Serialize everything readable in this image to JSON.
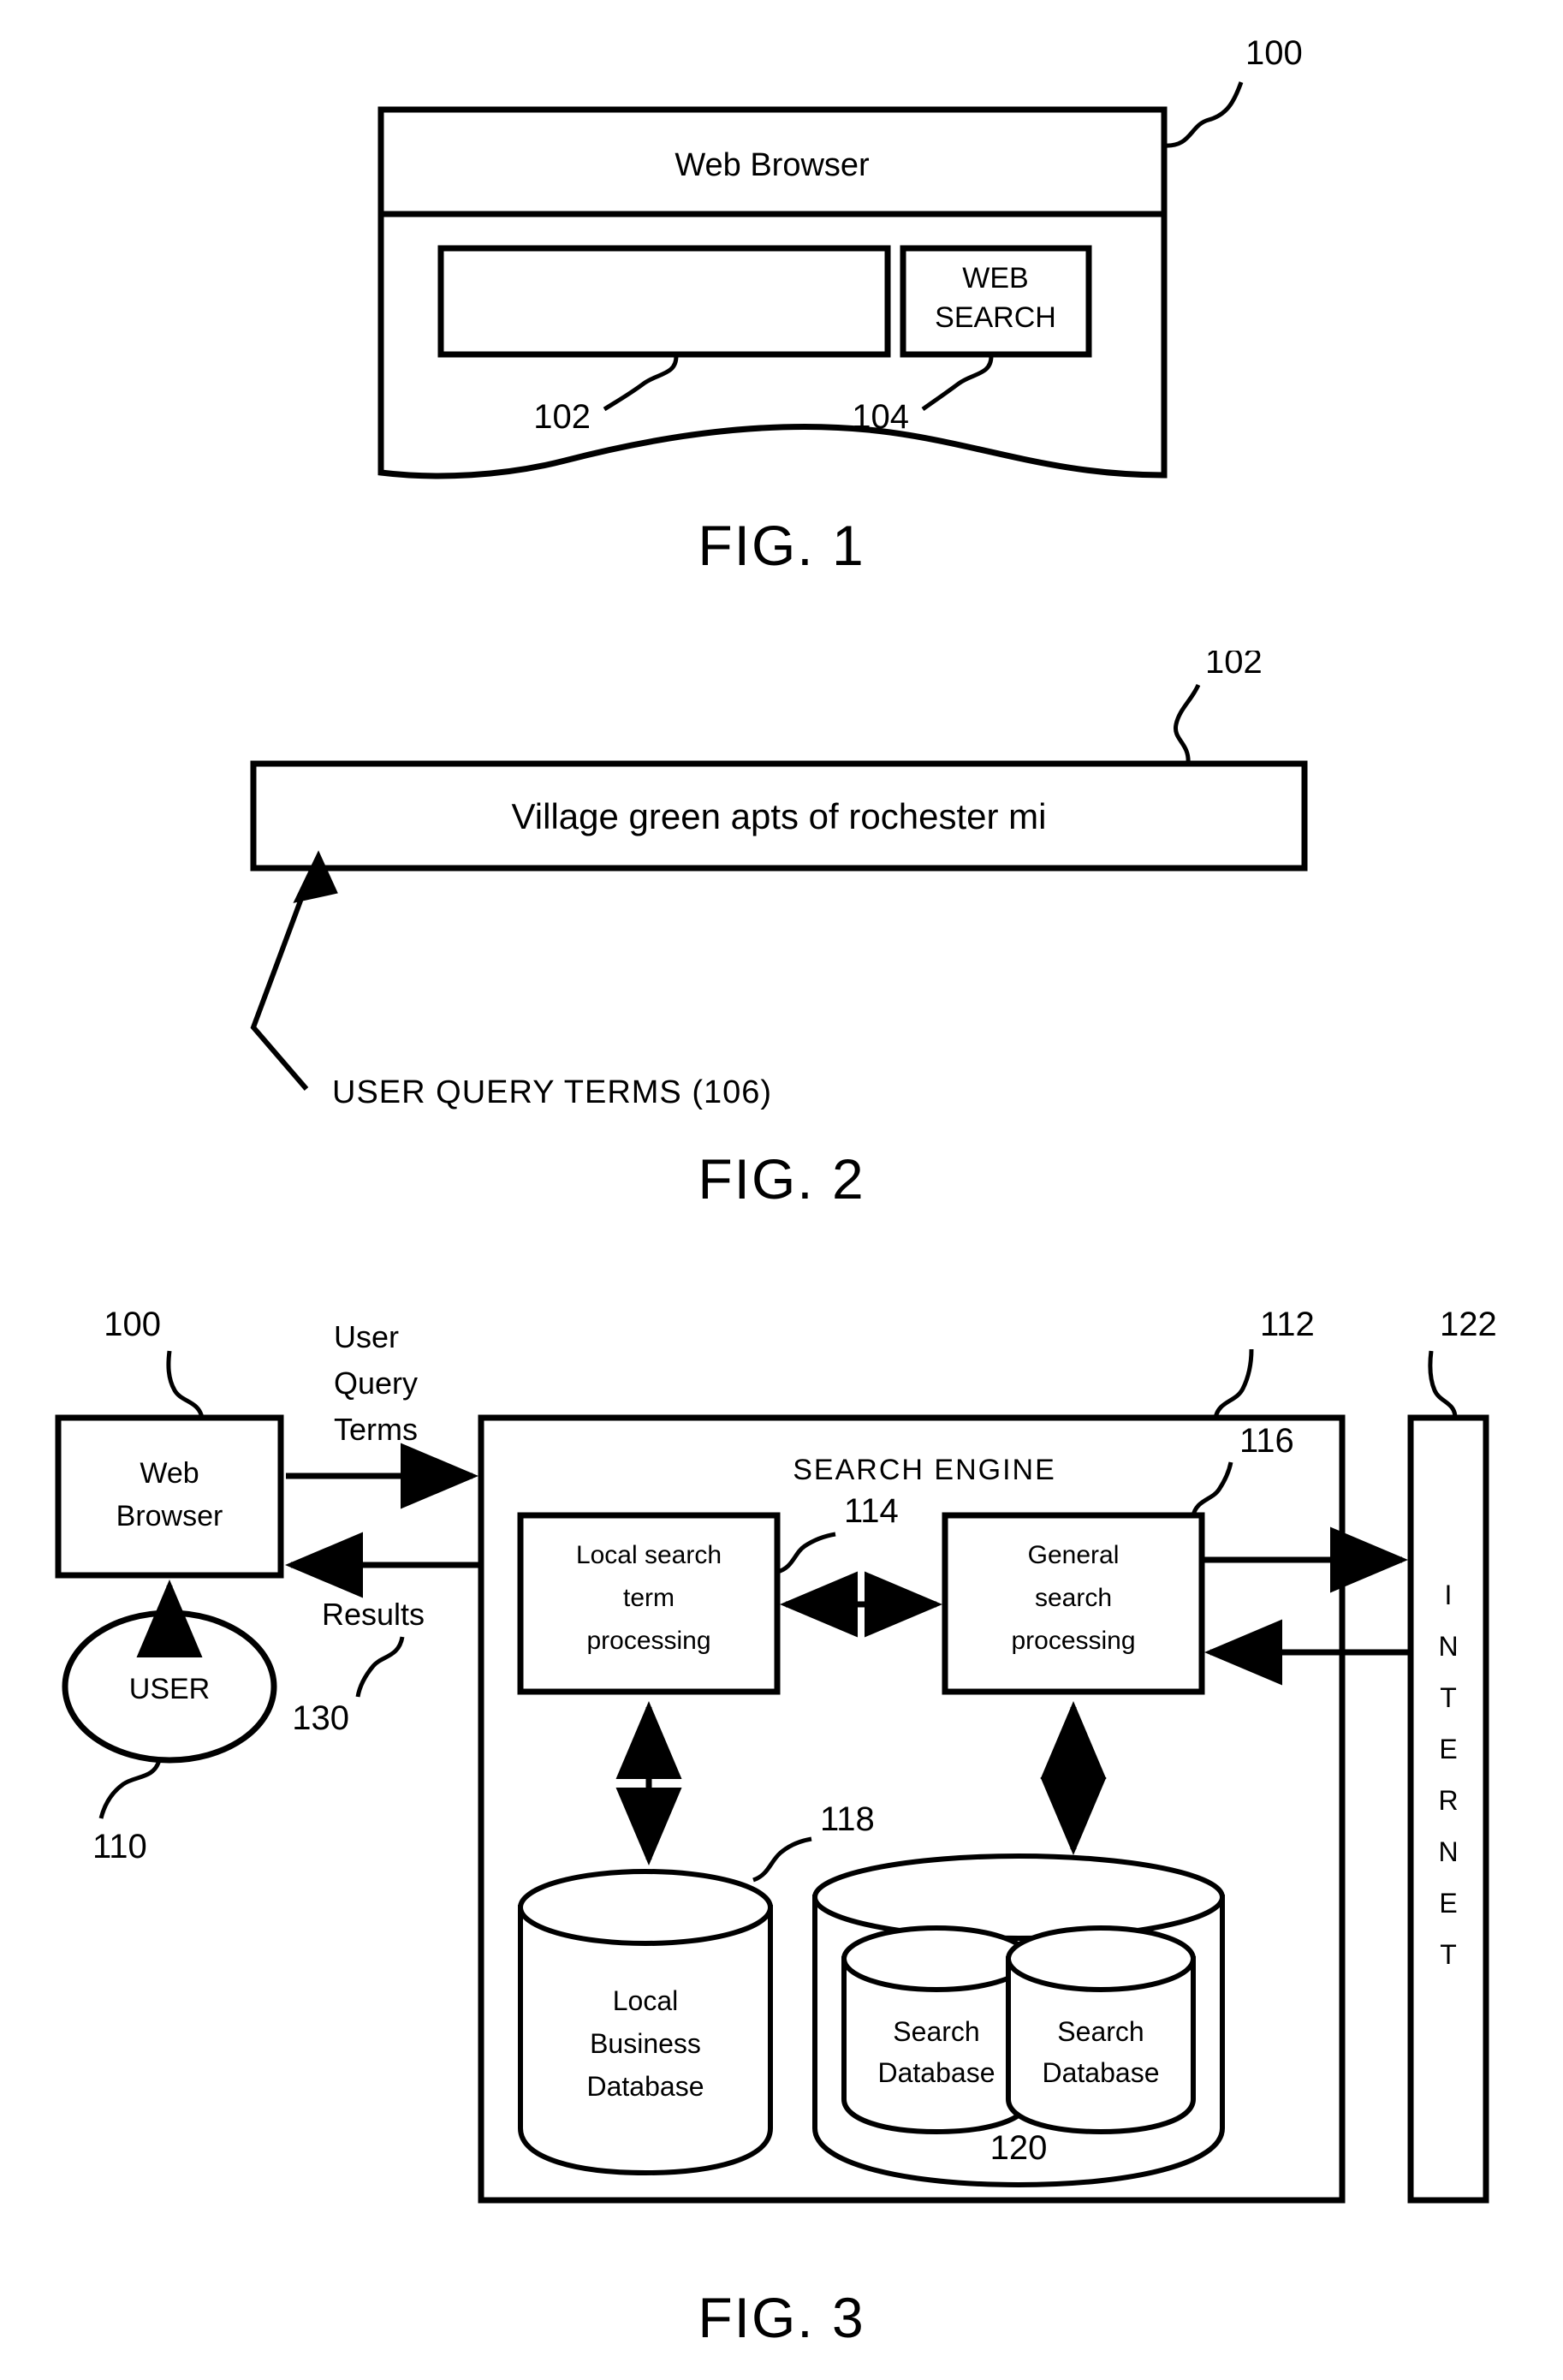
{
  "document": {
    "type": "patent-drawing-sheet",
    "figures": [
      "FIG. 1",
      "FIG. 2",
      "FIG. 3"
    ]
  },
  "fig1": {
    "caption": "FIG. 1",
    "window_title": "Web Browser",
    "search_input_value": "",
    "search_button_label_line1": "WEB",
    "search_button_label_line2": "SEARCH",
    "ref_window": "100",
    "ref_input": "102",
    "ref_button": "104"
  },
  "fig2": {
    "caption": "FIG. 2",
    "query_value": "Village green apts of rochester mi",
    "ref_input": "102",
    "annotation": "USER QUERY TERMS (106)"
  },
  "fig3": {
    "caption": "FIG. 3",
    "web_browser": {
      "line1": "Web",
      "line2": "Browser",
      "ref": "100"
    },
    "user": {
      "label": "USER",
      "ref": "110"
    },
    "flow_to_engine": {
      "line1": "User",
      "line2": "Query",
      "line3": "Terms"
    },
    "flow_to_browser": {
      "label": "Results",
      "ref": "130"
    },
    "search_engine": {
      "title": "SEARCH ENGINE",
      "ref": "112"
    },
    "local_search": {
      "line1": "Local search",
      "line2": "term",
      "line3": "processing",
      "ref": "114"
    },
    "general_search": {
      "line1": "General",
      "line2": "search",
      "line3": "processing",
      "ref": "116"
    },
    "local_business_db": {
      "line1": "Local",
      "line2": "Business",
      "line3": "Database",
      "ref": "118"
    },
    "search_db_group": {
      "ref": "120"
    },
    "search_db_1": {
      "line1": "Search",
      "line2": "Database"
    },
    "search_db_2": {
      "line1": "Search",
      "line2": "Database"
    },
    "internet": {
      "letters": [
        "I",
        "N",
        "T",
        "E",
        "R",
        "N",
        "E",
        "T"
      ],
      "ref": "122"
    }
  },
  "style": {
    "ink": "#000000",
    "paper": "#ffffff"
  }
}
